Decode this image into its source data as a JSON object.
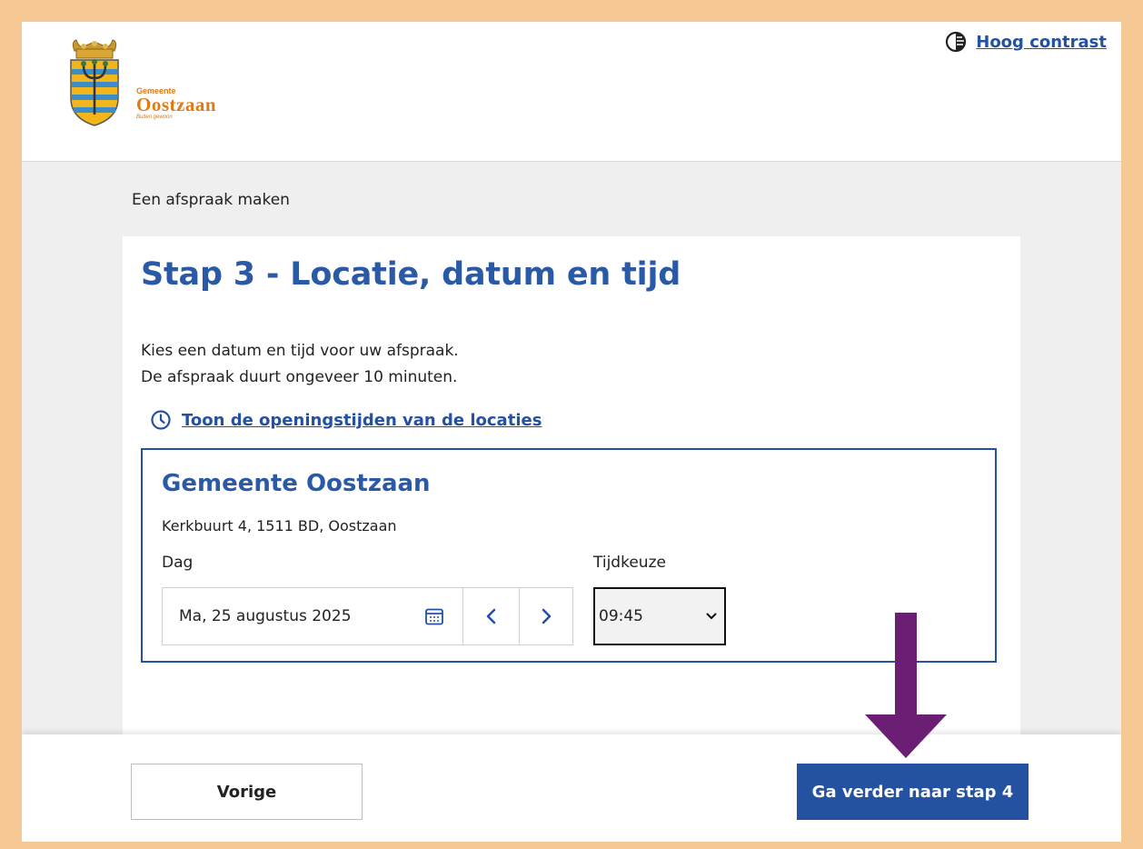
{
  "header": {
    "logo": {
      "small": "Gemeente",
      "big": "Oostzaan",
      "tagline": "Buiten gewoon"
    },
    "contrast_label": "Hoog contrast",
    "contrast_icon": "contrast-icon"
  },
  "breadcrumb": "Een afspraak maken",
  "step": {
    "title": "Stap 3 - Locatie, datum en tijd",
    "intro_line1": "Kies een datum en tijd voor uw afspraak.",
    "intro_line2": "De afspraak duurt ongeveer 10 minuten.",
    "hours_link": "Toon de openingstijden van de locaties",
    "hours_icon": "clock-icon"
  },
  "location": {
    "name": "Gemeente Oostzaan",
    "address": "Kerkbuurt 4, 1511 BD, Oostzaan",
    "day_label": "Dag",
    "day_value": "Ma, 25 augustus 2025",
    "time_label": "Tijdkeuze",
    "time_value": "09:45"
  },
  "footer": {
    "prev_label": "Vorige",
    "next_label": "Ga verder naar stap 4"
  },
  "colors": {
    "primary": "#2452a0",
    "heading": "#2a5aa6",
    "page_border": "#f5c894",
    "annotation_arrow": "#6b1f74",
    "logo_orange": "#e07a16"
  }
}
